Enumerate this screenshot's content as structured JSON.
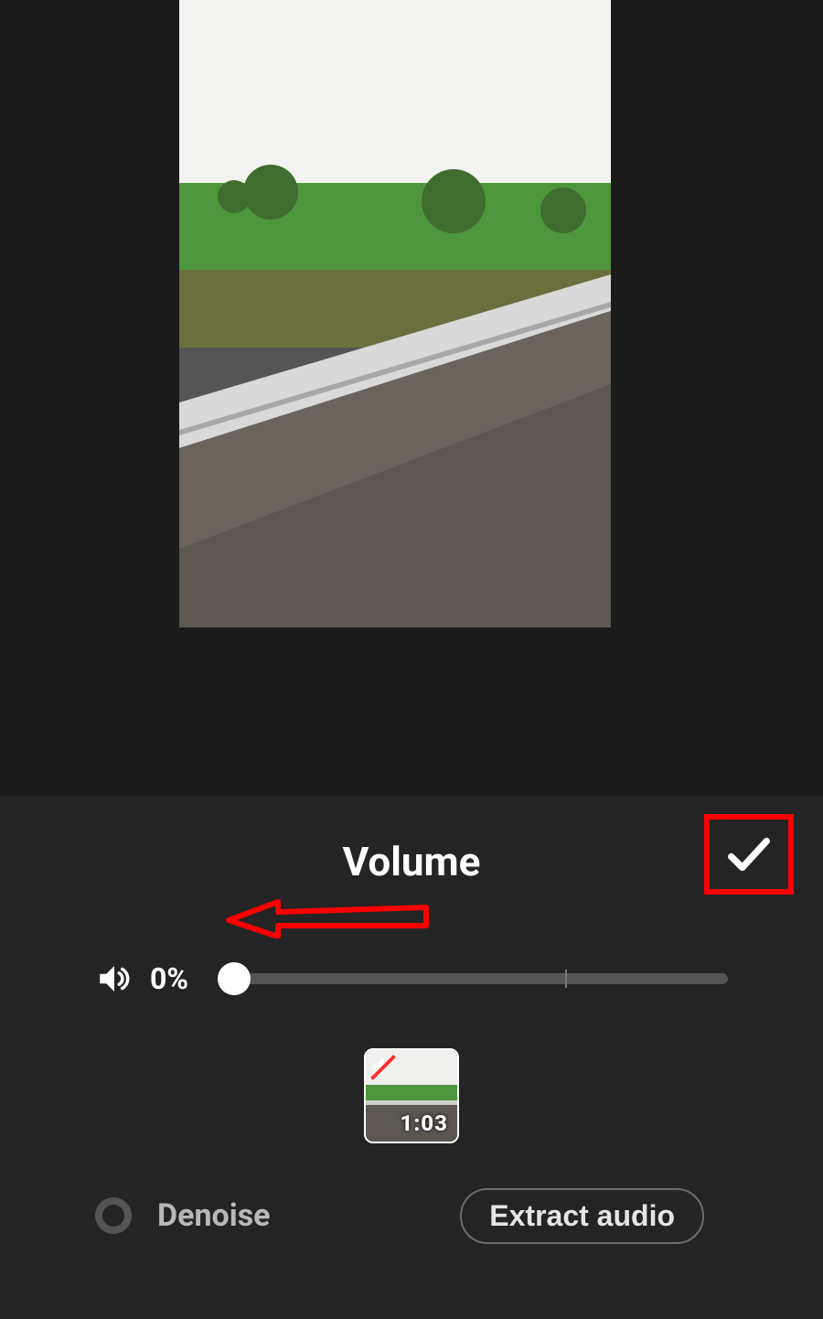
{
  "panel": {
    "title": "Volume",
    "volume_percent_text": "0%",
    "volume_value": 0,
    "volume_default_mark_percent": 67,
    "icons": {
      "confirm": "check-icon",
      "volume": "volume-icon",
      "arrow_annotation": "arrow-left-annotation",
      "mute_badge": "muted-icon"
    }
  },
  "clip": {
    "duration": "1:03",
    "muted": true
  },
  "actions": {
    "denoise_label": "Denoise",
    "denoise_on": false,
    "extract_label": "Extract audio"
  },
  "annotation": {
    "confirm_highlight_color": "#ff0000",
    "arrow_color": "#ff0000"
  }
}
